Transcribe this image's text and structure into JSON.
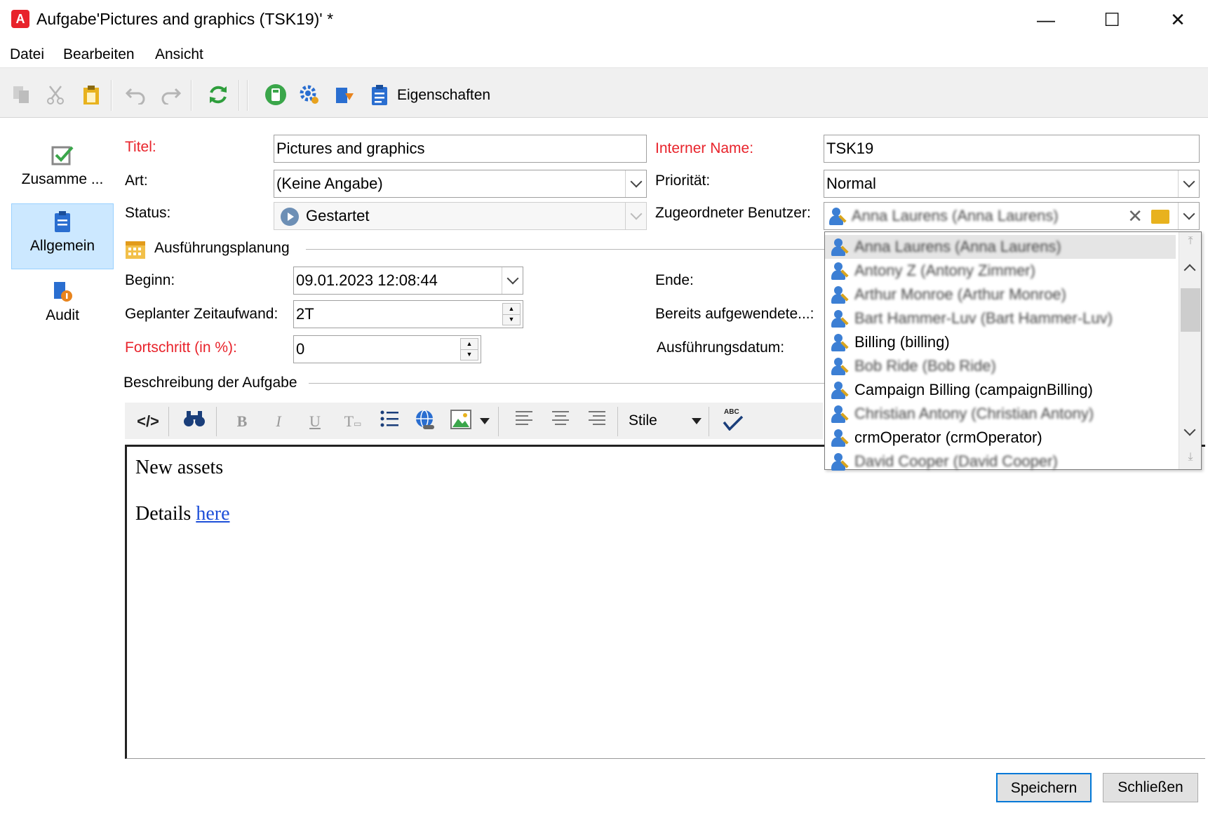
{
  "window": {
    "logo": "A",
    "title_prefix": "Aufgabe",
    "title_rest": "'Pictures and graphics (TSK19)' *",
    "minimize": "—",
    "maximize": "☐",
    "close": "✕"
  },
  "menu": [
    "Datei",
    "Bearbeiten",
    "Ansicht"
  ],
  "toolbar": {
    "properties_label": "Eigenschaften",
    "icons": [
      "copy-icon",
      "cut-icon",
      "paste-icon",
      "undo-icon",
      "redo-icon",
      "refresh-icon",
      "calculator-icon",
      "settings-gear-icon",
      "export-icon",
      "properties-clipboard-icon"
    ]
  },
  "nav": {
    "summary": "Zusamme ...",
    "general": "Allgemein",
    "audit": "Audit"
  },
  "form": {
    "title_label": "Titel:",
    "title_value": "Pictures and graphics",
    "internal_name_label": "Interner Name:",
    "internal_name_value": "TSK19",
    "type_label": "Art:",
    "type_value": "(Keine Angabe)",
    "priority_label": "Priorität:",
    "priority_value": "Normal",
    "status_label": "Status:",
    "status_value": "Gestartet",
    "assigned_user_label": "Zugeordneter Benutzer:",
    "assigned_user_value": "Anna Laurens (Anna Laurens)",
    "planning_section": "Ausführungsplanung",
    "start_label": "Beginn:",
    "start_value": "09.01.2023 12:08:44",
    "end_label": "Ende:",
    "planned_effort_label": "Geplanter Zeitaufwand:",
    "planned_effort_value": "2T",
    "spent_label": "Bereits aufgewendete...:",
    "progress_label": "Fortschritt (in %):",
    "progress_value": "0",
    "execution_date_label": "Ausführungsdatum:",
    "description_section": "Beschreibung der Aufgabe"
  },
  "editor_toolbar": {
    "style_label": "Stile",
    "spellcheck": "ABC"
  },
  "editor": {
    "line1": "New assets",
    "line2_text": "Details ",
    "line2_link": "here"
  },
  "user_dropdown": {
    "items": [
      {
        "label": "Anna Laurens (Anna Laurens)",
        "blurred": true,
        "selected": true
      },
      {
        "label": "Antony Z (Antony Zimmer)",
        "blurred": true,
        "selected": false
      },
      {
        "label": "Arthur Monroe (Arthur Monroe)",
        "blurred": true,
        "selected": false
      },
      {
        "label": "Bart Hammer-Luv (Bart Hammer-Luv)",
        "blurred": true,
        "selected": false
      },
      {
        "label": "Billing (billing)",
        "blurred": false,
        "selected": false
      },
      {
        "label": "Bob Ride (Bob Ride)",
        "blurred": true,
        "selected": false
      },
      {
        "label": "Campaign Billing (campaignBilling)",
        "blurred": false,
        "selected": false
      },
      {
        "label": "Christian Antony (Christian Antony)",
        "blurred": true,
        "selected": false
      },
      {
        "label": "crmOperator (crmOperator)",
        "blurred": false,
        "selected": false
      },
      {
        "label": "David Cooper (David Cooper)",
        "blurred": true,
        "selected": false
      }
    ]
  },
  "buttons": {
    "save": "Speichern",
    "close": "Schließen"
  },
  "colors": {
    "required_label": "#e8232b",
    "nav_active_bg": "#cce8ff",
    "link": "#1d4fd8",
    "primary_border": "#0078d7"
  }
}
